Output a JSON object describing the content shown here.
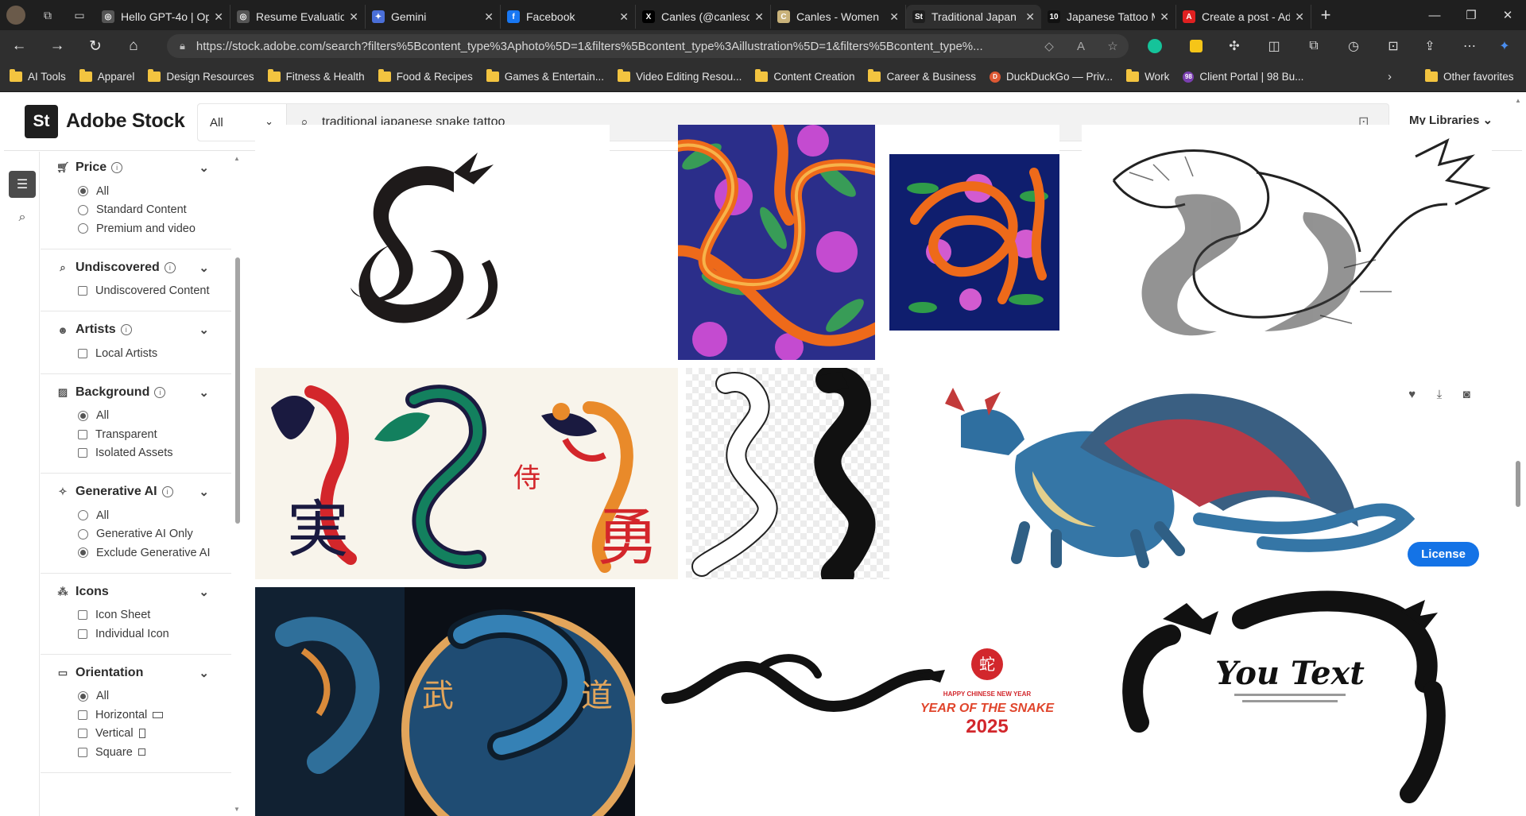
{
  "browser": {
    "tabs": [
      {
        "title": "Hello GPT-4o | Op",
        "fav_color": "#555555",
        "fav_glyph": "◎"
      },
      {
        "title": "Resume Evaluatio",
        "fav_color": "#555555",
        "fav_glyph": "◎"
      },
      {
        "title": "Gemini",
        "fav_color": "#4a6fd8",
        "fav_glyph": "✦"
      },
      {
        "title": "Facebook",
        "fav_color": "#1877f2",
        "fav_glyph": "f"
      },
      {
        "title": "Canles (@canleso",
        "fav_color": "#000000",
        "fav_glyph": "X"
      },
      {
        "title": "Canles - Women",
        "fav_color": "#c9b27a",
        "fav_glyph": "C"
      },
      {
        "title": "Traditional Japan",
        "fav_color": "#1e1e1e",
        "fav_glyph": "St",
        "active": true
      },
      {
        "title": "Japanese Tattoo M",
        "fav_color": "#111111",
        "fav_glyph": "10"
      },
      {
        "title": "Create a post - Ad",
        "fav_color": "#e02020",
        "fav_glyph": "A"
      }
    ],
    "url": "https://stock.adobe.com/search?filters%5Bcontent_type%3Aphoto%5D=1&filters%5Bcontent_type%3Aillustration%5D=1&filters%5Bcontent_type%...",
    "bookmarks": [
      {
        "label": "AI Tools",
        "type": "folder"
      },
      {
        "label": "Apparel",
        "type": "folder"
      },
      {
        "label": "Design Resources",
        "type": "folder"
      },
      {
        "label": "Fitness & Health",
        "type": "folder"
      },
      {
        "label": "Food & Recipes",
        "type": "folder"
      },
      {
        "label": "Games & Entertain...",
        "type": "folder"
      },
      {
        "label": "Video Editing Resou...",
        "type": "folder"
      },
      {
        "label": "Content Creation",
        "type": "folder"
      },
      {
        "label": "Career & Business",
        "type": "folder"
      },
      {
        "label": "DuckDuckGo — Priv...",
        "type": "site",
        "color": "#de5833",
        "glyph": "D"
      },
      {
        "label": "Work",
        "type": "folder"
      },
      {
        "label": "Client Portal | 98 Bu...",
        "type": "site",
        "color": "#7a3fb0",
        "glyph": "98"
      }
    ],
    "other_favorites": "Other favorites"
  },
  "header": {
    "brand_mark": "St",
    "brand": "Adobe Stock",
    "search_scope": "All",
    "search_query": "traditional japanese snake tattoo",
    "my_libraries": "My Libraries"
  },
  "filters": {
    "price": {
      "title": "Price",
      "options": [
        {
          "label": "All",
          "checked": true
        },
        {
          "label": "Standard Content",
          "checked": false
        },
        {
          "label": "Premium and video",
          "checked": false
        }
      ]
    },
    "undiscovered": {
      "title": "Undiscovered",
      "options": [
        {
          "label": "Undiscovered Content",
          "checked": false
        }
      ]
    },
    "artists": {
      "title": "Artists",
      "options": [
        {
          "label": "Local Artists",
          "checked": false
        }
      ]
    },
    "background": {
      "title": "Background",
      "options": [
        {
          "label": "All",
          "checked": true
        },
        {
          "label": "Transparent",
          "checked": false
        },
        {
          "label": "Isolated Assets",
          "checked": false
        }
      ]
    },
    "generative_ai": {
      "title": "Generative AI",
      "options": [
        {
          "label": "All",
          "checked": false
        },
        {
          "label": "Generative AI Only",
          "checked": false
        },
        {
          "label": "Exclude Generative AI",
          "checked": true
        }
      ]
    },
    "icons": {
      "title": "Icons",
      "options": [
        {
          "label": "Icon Sheet",
          "checked": false
        },
        {
          "label": "Individual Icon",
          "checked": false
        }
      ]
    },
    "orientation": {
      "title": "Orientation",
      "options": [
        {
          "label": "All",
          "checked": true
        },
        {
          "label": "Horizontal",
          "checked": false
        },
        {
          "label": "Vertical",
          "checked": false
        },
        {
          "label": "Square",
          "checked": false
        }
      ]
    }
  },
  "results": {
    "license_label": "License",
    "tile_text": {
      "kanji_left": "実",
      "kanji_mid": "侍",
      "kanji_right": "勇",
      "kanji_bu": "武",
      "kanji_do": "道",
      "snake_char": "蛇",
      "cny_line1": "HAPPY CHINESE NEW YEAR",
      "cny_line2": "YEAR OF THE SNAKE",
      "cny_year": "2025",
      "you_text": "You Text"
    }
  },
  "colors": {
    "accent": "#1473e6",
    "chrome_dark": "#1f1f1f",
    "chrome": "#2f2f2f",
    "folder": "#f3c440"
  }
}
